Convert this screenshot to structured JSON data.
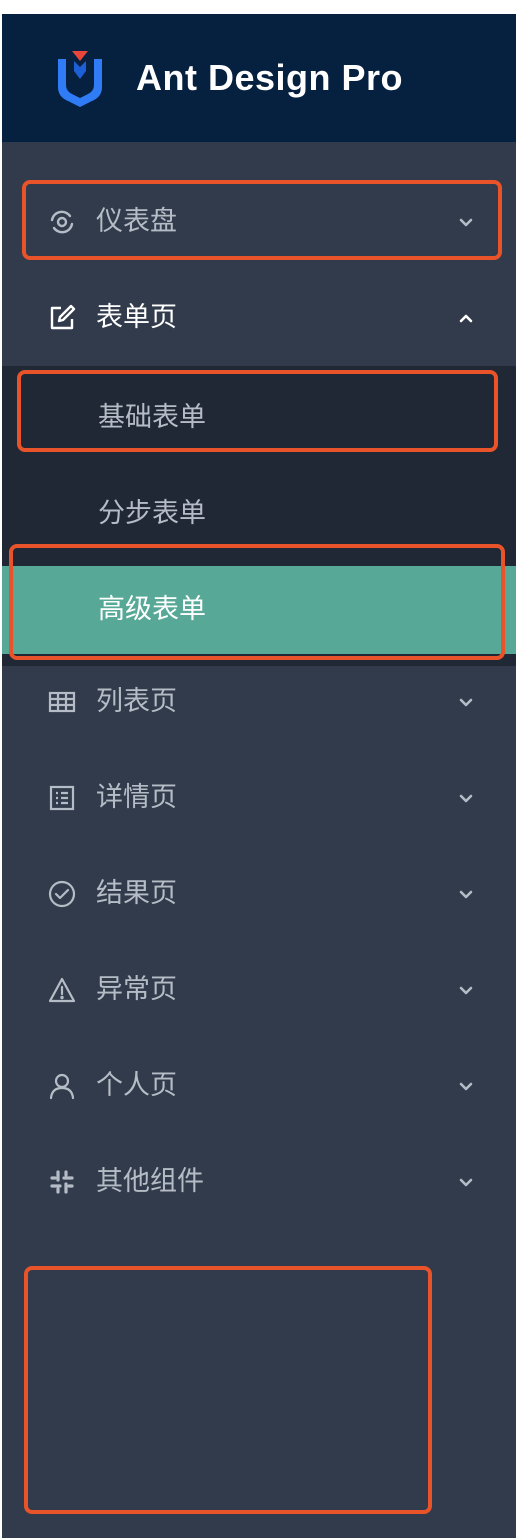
{
  "brand": {
    "title": "Ant Design Pro",
    "logo_icon": "ant-design-pro-logo",
    "colors": {
      "logo_blue": "#2f7cf6",
      "logo_red": "#e8453c"
    }
  },
  "colors": {
    "sider_bg": "#323b4c",
    "header_bg": "#06203f",
    "submenu_bg": "#202735",
    "selected_bg": "#57a896",
    "highlight_border": "#e9532a",
    "text_muted": "#b5bcc6",
    "text_active": "#ffffff"
  },
  "menu": {
    "items": [
      {
        "label": "仪表盘",
        "icon": "dashboard-icon",
        "arrow": "chevron-down-icon"
      },
      {
        "label": "表单页",
        "icon": "form-edit-icon",
        "arrow": "chevron-up-icon",
        "open": true,
        "children": [
          {
            "label": "基础表单"
          },
          {
            "label": "分步表单"
          },
          {
            "label": "高级表单",
            "selected": true
          }
        ]
      },
      {
        "label": "列表页",
        "icon": "table-icon",
        "arrow": "chevron-down-icon"
      },
      {
        "label": "详情页",
        "icon": "profile-icon",
        "arrow": "chevron-down-icon"
      },
      {
        "label": "结果页",
        "icon": "check-circle-icon",
        "arrow": "chevron-down-icon"
      },
      {
        "label": "异常页",
        "icon": "warning-icon",
        "arrow": "chevron-down-icon"
      },
      {
        "label": "个人页",
        "icon": "user-icon",
        "arrow": "chevron-down-icon"
      },
      {
        "label": "其他组件",
        "icon": "slack-icon",
        "arrow": "chevron-down-icon"
      }
    ]
  }
}
